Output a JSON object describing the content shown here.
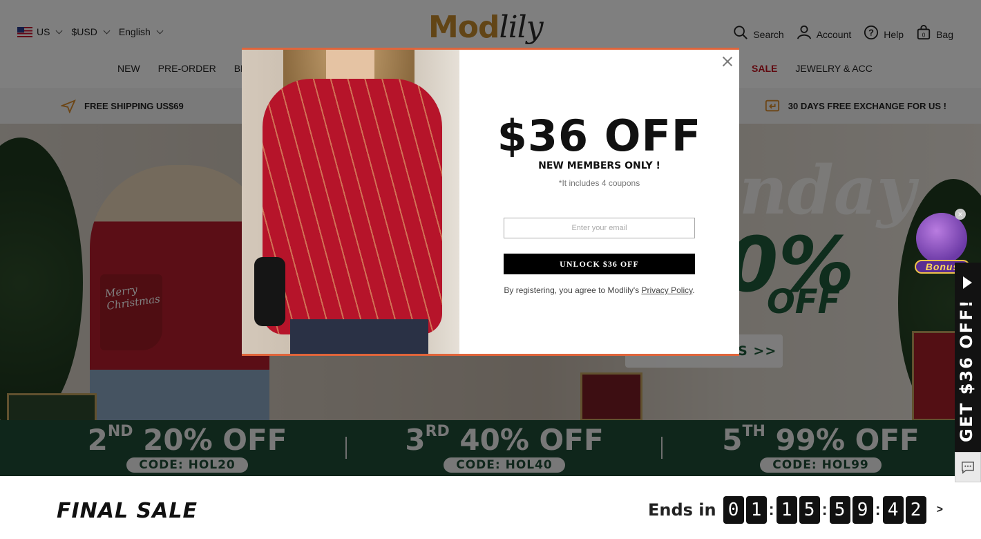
{
  "header": {
    "locale": {
      "country": "US",
      "currency": "$USD",
      "language": "English"
    },
    "logo": {
      "part1": "Mod",
      "part2": "lily"
    },
    "tools": {
      "search": "Search",
      "account": "Account",
      "help": "Help",
      "bag": "Bag",
      "bag_count": "0"
    }
  },
  "nav": {
    "items": [
      "NEW",
      "PRE-ORDER",
      "BES"
    ],
    "sale": "SALE",
    "jewelry": "JEWELRY & ACC"
  },
  "promo": {
    "left": "FREE SHIPPING US$69",
    "right": "30 DAYS FREE EXCHANGE FOR US !"
  },
  "hero": {
    "headline_partial": "nday",
    "percent_partial": "0%",
    "off": "OFF",
    "button_partial": "MORE DETAILS >>",
    "stocking_text": "Merry Christmas"
  },
  "coupons": [
    {
      "ordinal": "2",
      "suffix": "ND",
      "offer": "20% OFF",
      "code": "CODE: HOL20"
    },
    {
      "ordinal": "3",
      "suffix": "RD",
      "offer": "40% OFF",
      "code": "CODE: HOL40"
    },
    {
      "ordinal": "5",
      "suffix": "TH",
      "offer": "99% OFF",
      "code": "CODE: HOL99"
    }
  ],
  "final_sale": {
    "title": "FINAL SALE",
    "ends_label": "Ends in",
    "digits": [
      "0",
      "1",
      "1",
      "5",
      "5",
      "9",
      "4",
      "2"
    ],
    "more": ">"
  },
  "side": {
    "tab_text": "GET $36 OFF!",
    "bonus": "Bonus",
    "bonus_close": "×"
  },
  "modal": {
    "title": "$36 OFF",
    "subtitle": "NEW MEMBERS ONLY !",
    "note": "*It includes 4 coupons",
    "email_placeholder": "Enter your email",
    "button": "UNLOCK $36 OFF",
    "terms_prefix": "By registering, you agree to Modlily's ",
    "terms_link": "Privacy Policy",
    "terms_suffix": ".",
    "accent_color": "#e0653b"
  }
}
